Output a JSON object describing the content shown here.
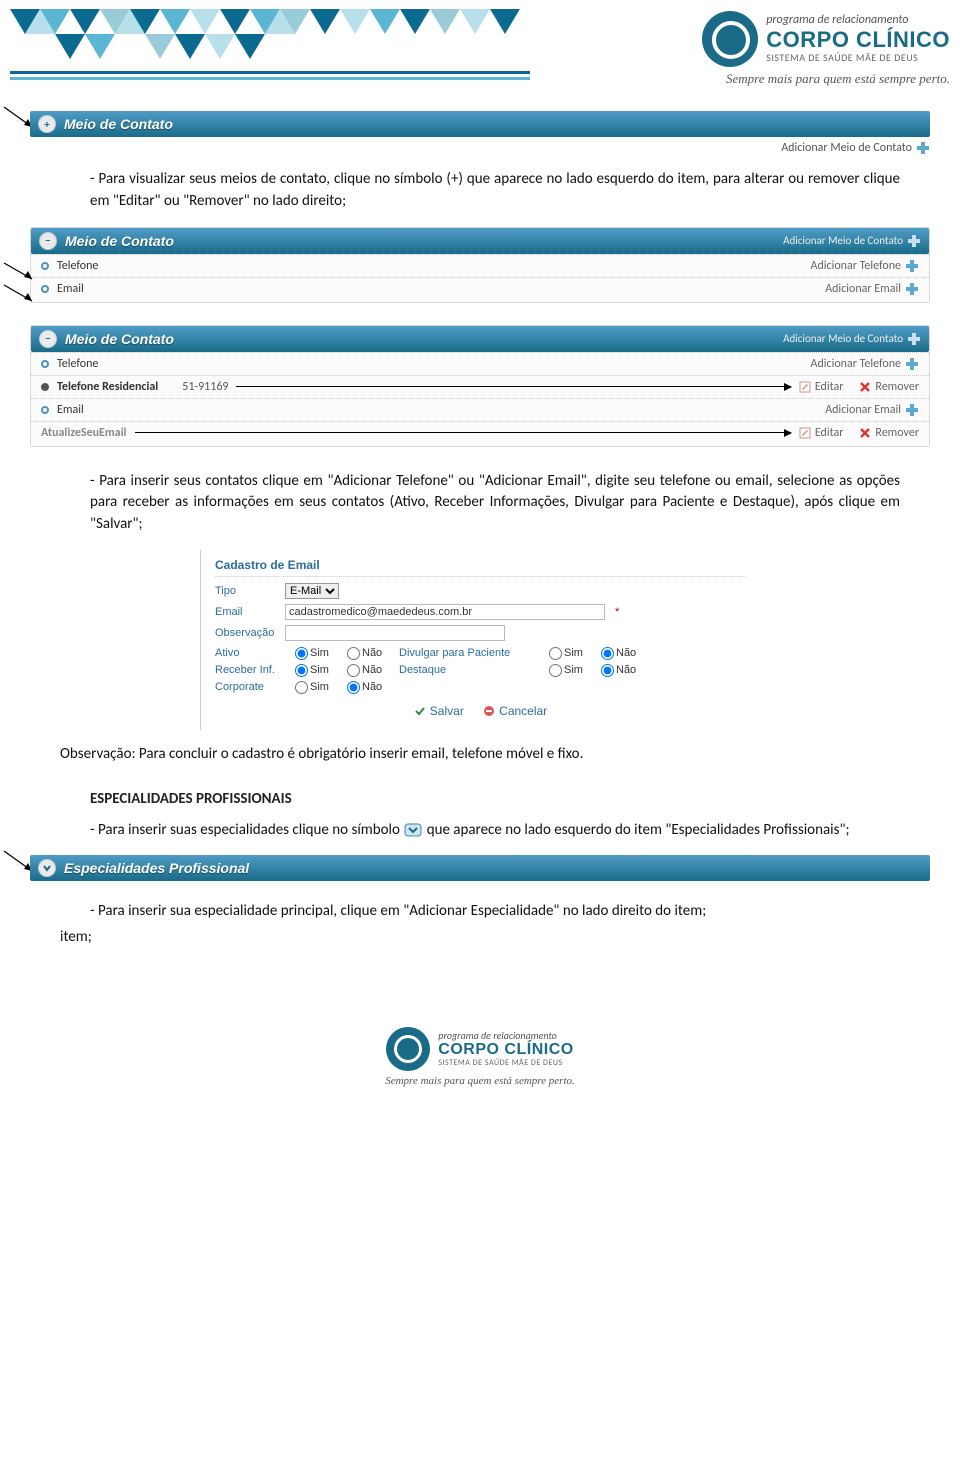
{
  "header": {
    "program": "programa de relacionamento",
    "brand": "CORPO CLÍNICO",
    "system": "SISTEMA DE SAÚDE MÃE DE DEUS",
    "tagline": "Sempre mais para quem está sempre perto."
  },
  "section": {
    "meio_contato": "Meio de Contato",
    "especialidades": "Especialidades Profissional",
    "add_contato": "Adicionar Meio de Contato",
    "add_telefone": "Adicionar Telefone",
    "add_email": "Adicionar Email",
    "editar": "Editar",
    "remover": "Remover",
    "telefone": "Telefone",
    "email": "Email",
    "tel_res": "Telefone Residencial",
    "tel_res_num": "51-91169",
    "atualize": "AtualizeSeuEmail"
  },
  "para1": "- Para visualizar seus meios de contato, clique no símbolo (+) que aparece no lado esquerdo do item, para alterar ou remover clique em \"Editar\" ou \"Remover\" no lado direito;",
  "para2": "- Para inserir seus contatos clique em \"Adicionar Telefone\" ou \"Adicionar Email\", digite seu telefone ou email, selecione as opções para receber as informações em seus contatos (Ativo, Receber Informações, Divulgar para Paciente e Destaque), após clique em \"Salvar\";",
  "obs": "Observação: Para concluir o cadastro é obrigatório inserir email, telefone móvel e fixo.",
  "spec_heading": "ESPECIALIDADES PROFISSIONAIS",
  "spec_p_a": "- Para inserir suas especialidades clique no símbolo ",
  "spec_p_b": " que aparece no lado esquerdo do item \"Especialidades Profissionais\";",
  "spec_p2": "- Para inserir sua especialidade principal, clique em \"Adicionar Especialidade\" no lado direito do item;",
  "form": {
    "title": "Cadastro de Email",
    "tipo_label": "Tipo",
    "tipo_value": "E-Mail",
    "email_label": "Email",
    "email_value": "cadastromedico@maededeus.com.br",
    "obs_label": "Observação",
    "obs_value": "",
    "ativo": "Ativo",
    "recinf": "Receber Inf.",
    "corp": "Corporate",
    "divpac": "Divulgar para Paciente",
    "dest": "Destaque",
    "sim": "Sim",
    "nao": "Não",
    "salvar": "Salvar",
    "cancelar": "Cancelar"
  },
  "item_label": "item;"
}
